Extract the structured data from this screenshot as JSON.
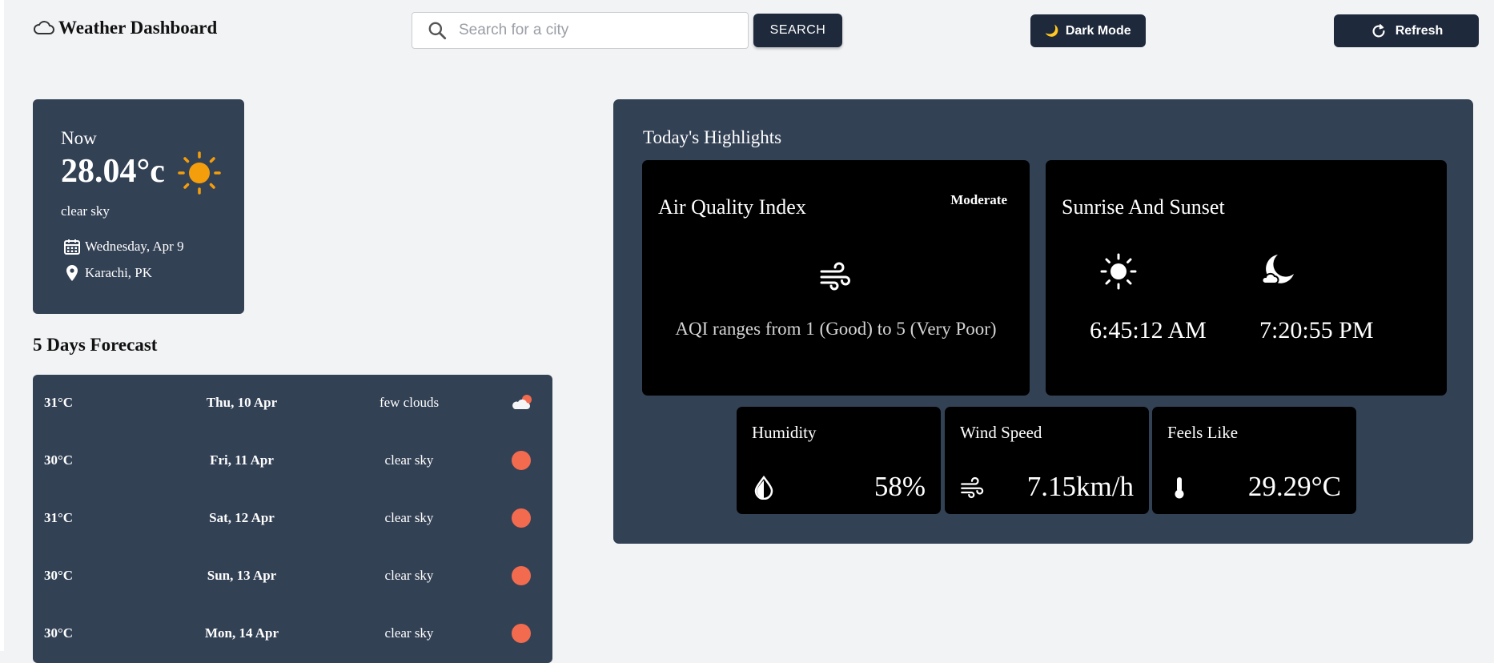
{
  "header": {
    "title": "Weather Dashboard",
    "search_placeholder": "Search for a city",
    "search_button": "SEARCH",
    "dark_mode_icon": "🌙",
    "dark_mode_label": "Dark Mode",
    "refresh_label": "Refresh"
  },
  "current": {
    "label": "Now",
    "temperature": "28.04°c",
    "description": "clear sky",
    "date": "Wednesday, Apr 9",
    "location": "Karachi, PK"
  },
  "forecast": {
    "title": "5 Days Forecast",
    "days": [
      {
        "temp": "31°C",
        "day": "Thu, 10 Apr",
        "desc": "few clouds",
        "icon": "partly-cloudy-icon"
      },
      {
        "temp": "30°C",
        "day": "Fri, 11 Apr",
        "desc": "clear sky",
        "icon": "sun-dot-icon"
      },
      {
        "temp": "31°C",
        "day": "Sat, 12 Apr",
        "desc": "clear sky",
        "icon": "sun-dot-icon"
      },
      {
        "temp": "30°C",
        "day": "Sun, 13 Apr",
        "desc": "clear sky",
        "icon": "sun-dot-icon"
      },
      {
        "temp": "30°C",
        "day": "Mon, 14 Apr",
        "desc": "clear sky",
        "icon": "sun-dot-icon"
      }
    ]
  },
  "highlights": {
    "title": "Today's Highlights",
    "aqi": {
      "title": "Air Quality Index",
      "badge": "Moderate",
      "note": "AQI ranges from 1 (Good) to 5 (Very Poor)"
    },
    "sun": {
      "title": "Sunrise And Sunset",
      "sunrise": "6:45:12 AM",
      "sunset": "7:20:55 PM"
    },
    "humidity": {
      "title": "Humidity",
      "value": "58%"
    },
    "wind": {
      "title": "Wind Speed",
      "value": "7.15km/h"
    },
    "feels_like": {
      "title": "Feels Like",
      "value": "29.29°C"
    }
  },
  "colors": {
    "background": "#f2f3f5",
    "card": "#334155",
    "button": "#1e293b",
    "panel": "#000000",
    "sun_accent": "#f59e0b",
    "forecast_dot": "#f26b4f"
  }
}
